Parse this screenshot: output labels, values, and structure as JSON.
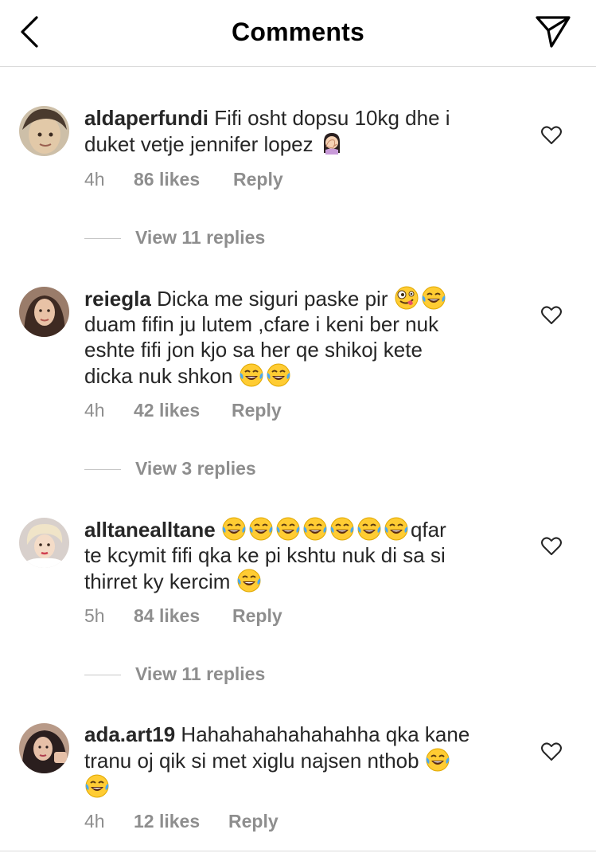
{
  "header": {
    "title": "Comments"
  },
  "comments": [
    {
      "username": "aldaperfundi",
      "text_line1": "Fifi osht dopsu 10kg dhe i",
      "text_line2": "duket vetje jennifer lopez",
      "time": "4h",
      "likes": "86 likes",
      "reply": "Reply",
      "view_replies": "View 11 replies",
      "avatar_colors": [
        "#d9c6a8",
        "#5a4a3a"
      ]
    },
    {
      "username": "reiegla",
      "text_line1": "Dicka me siguri paske pir",
      "text_line2": "duam fifin ju lutem ,cfare i  keni ber nuk",
      "text_line3": "eshte fifi jon kjo sa her qe shikoj kete",
      "text_line4": "dicka nuk shkon",
      "time": "4h",
      "likes": "42 likes",
      "reply": "Reply",
      "view_replies": "View 3 replies",
      "avatar_colors": [
        "#b08a70",
        "#3e2a20"
      ]
    },
    {
      "username": "alltanealltane",
      "text_line1_suffix": "qfar",
      "text_line2": "te kcymit fifi qka ke pi kshtu nuk di sa si",
      "text_line3": "thirret ky kercim",
      "time": "5h",
      "likes": "84 likes",
      "reply": "Reply",
      "view_replies": "View 11 replies",
      "avatar_colors": [
        "#e8d2c0",
        "#c9a27a"
      ]
    },
    {
      "username": "ada.art19",
      "text_line1": "Hahahahahahahahha qka kane",
      "text_line2": "tranu oj qik si met xiglu najsen nthob",
      "time": "4h",
      "likes": "12 likes",
      "reply": "Reply",
      "avatar_colors": [
        "#c8a890",
        "#2a2020"
      ]
    }
  ],
  "icons": {
    "back": "chevron-left-icon",
    "send": "paper-plane-icon",
    "heart": "heart-outline-icon",
    "laugh": "face-with-tears-of-joy",
    "zany": "zany-face",
    "facepalm": "woman-facepalming"
  }
}
